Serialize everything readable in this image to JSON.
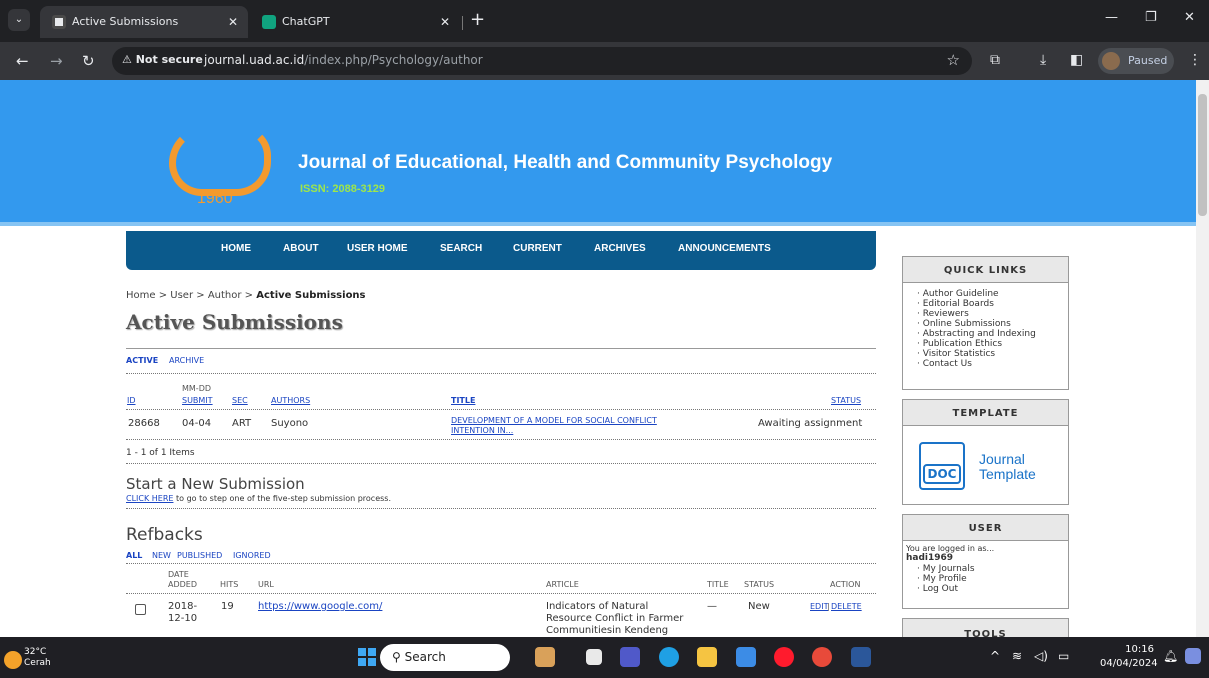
{
  "browser": {
    "tabs": [
      {
        "title": "Active Submissions",
        "active": true
      },
      {
        "title": "ChatGPT",
        "active": false
      }
    ],
    "not_secure": "Not secure",
    "url_host": "journal.uad.ac.id",
    "url_path": "/index.php/Psychology/author",
    "profile_status": "Paused",
    "icons": {
      "menu": "chevron-down-icon",
      "close": "close-icon",
      "back": "back-arrow-icon",
      "forward": "forward-arrow-icon",
      "reload": "reload-icon",
      "warning": "warning-icon",
      "star": "star-icon",
      "extension": "puzzle-icon",
      "download": "download-icon",
      "sidepanel": "sidepanel-icon",
      "kebab": "kebab-menu-icon"
    }
  },
  "journal": {
    "logo_year": "1960",
    "title": "Journal of Educational, Health and Community Psychology",
    "issn": "ISSN: 2088-3129",
    "colors": {
      "header": "#3399ee",
      "nav": "#0b5a8c",
      "logo": "#f39a2e",
      "issn": "#9ee64b"
    }
  },
  "nav": [
    "HOME",
    "ABOUT",
    "USER HOME",
    "SEARCH",
    "CURRENT",
    "ARCHIVES",
    "ANNOUNCEMENTS"
  ],
  "breadcrumb": {
    "home": "Home",
    "user": "User",
    "author": "Author",
    "current": "Active Submissions",
    "sep": " > "
  },
  "page_title": "Active Submissions",
  "subtabs": {
    "active": "ACTIVE",
    "archive": "ARCHIVE"
  },
  "submissions_table": {
    "headers": {
      "id": "ID",
      "date_top": "MM-DD",
      "date_bottom": "SUBMIT",
      "sec": "SEC",
      "authors": "AUTHORS",
      "title": "TITLE",
      "status": "STATUS"
    },
    "rows": [
      {
        "id": "28668",
        "date": "04-04",
        "sec": "ART",
        "authors": "Suyono",
        "title_l1": "DEVELOPMENT OF A MODEL FOR SOCIAL CONFLICT",
        "title_l2": "INTENTION IN...",
        "status": "Awaiting assignment"
      }
    ],
    "count": "1 - 1 of 1 Items"
  },
  "new_submission": {
    "heading": "Start a New Submission",
    "link": "CLICK HERE",
    "text": " to go to step one of the five-step submission process."
  },
  "refbacks": {
    "heading": "Refbacks",
    "filters": [
      "ALL",
      "NEW",
      "PUBLISHED",
      "IGNORED"
    ],
    "headers": {
      "date_top": "DATE",
      "date_bottom": "ADDED",
      "hits": "HITS",
      "url": "URL",
      "article": "ARTICLE",
      "title": "TITLE",
      "status": "STATUS",
      "action": "ACTION"
    },
    "rows": [
      {
        "date_l1": "2018-",
        "date_l2": "12-10",
        "hits": "19",
        "url": "https://www.google.com/",
        "article_l1": "Indicators of Natural",
        "article_l2": "Resource Conflict in Farmer",
        "article_l3": "Communitiesin Kendeng",
        "title": "—",
        "status": "New",
        "edit": "EDIT",
        "sep": " | ",
        "delete": "DELETE"
      }
    ]
  },
  "sidebar": {
    "quick_links": {
      "heading": "QUICK LINKS",
      "items": [
        "Author Guideline",
        "Editorial Boards",
        "Reviewers",
        "Online Submissions",
        "Abstracting and Indexing",
        "Publication Ethics",
        "Visitor Statistics",
        "Contact Us"
      ]
    },
    "template": {
      "heading": "TEMPLATE",
      "doc": "DOC",
      "line1": "Journal",
      "line2": "Template"
    },
    "user": {
      "heading": "USER",
      "logged_in": "You are logged in as...",
      "username": "hadi1969",
      "items": [
        "My Journals",
        "My Profile",
        "Log Out"
      ]
    },
    "tools": {
      "heading": "TOOLS"
    }
  },
  "taskbar": {
    "temp": "32°C",
    "weather": "Cerah",
    "search": "Search",
    "time": "10:16",
    "date": "04/04/2024"
  }
}
